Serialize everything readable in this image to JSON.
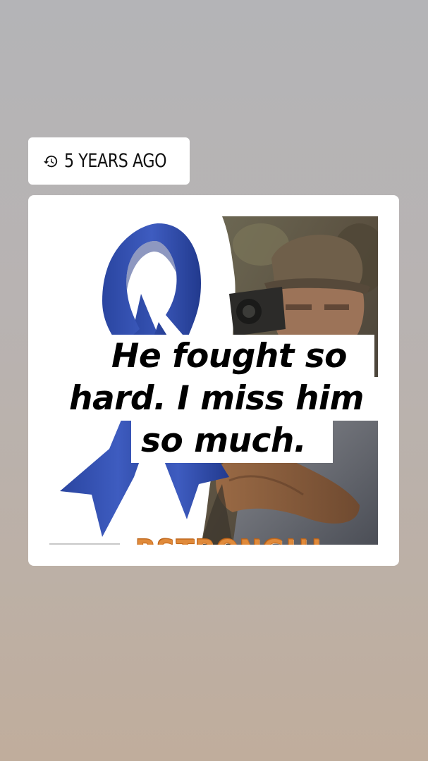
{
  "memory": {
    "time_label": "5 YEARS AGO",
    "icon": "history-icon"
  },
  "post": {
    "caption_lines": [
      "He fought so",
      "hard. I miss him",
      "so much."
    ],
    "image_text": "BSTRONG!!!",
    "ribbon_color": "#2f4ea8"
  }
}
